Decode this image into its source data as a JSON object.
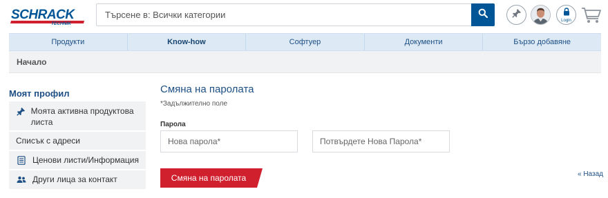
{
  "header": {
    "logo": {
      "line1": "SCHRACK",
      "line2": "TECHNIK"
    },
    "search": {
      "placeholder": "Търсене в: Всички категории"
    },
    "login_label": "Login"
  },
  "nav": {
    "items": [
      {
        "label": "Продукти",
        "bold": false
      },
      {
        "label": "Know-how",
        "bold": true
      },
      {
        "label": "Софтуер",
        "bold": false
      },
      {
        "label": "Документи",
        "bold": false
      },
      {
        "label": "Бързо добавяне",
        "bold": false
      }
    ]
  },
  "breadcrumb": {
    "home": "Начало"
  },
  "sidebar": {
    "title": "Моят профил",
    "items": [
      {
        "label": "Моята активна продуктова листа",
        "icon": "pin-icon"
      },
      {
        "label": "Списък с адреси",
        "icon": ""
      },
      {
        "label": "Ценови листи/Информация",
        "icon": "document-list-icon"
      },
      {
        "label": "Други лица за контакт",
        "icon": "contacts-icon"
      }
    ]
  },
  "main": {
    "title": "Смяна на паролата",
    "required_note": "*Задължително поле",
    "password_label": "Парола",
    "new_password_placeholder": "Нова парола*",
    "confirm_password_placeholder": "Потвърдете Нова Парола*",
    "submit_label": "Смяна на паролата",
    "back_link": "« Назад"
  },
  "colors": {
    "brand_blue": "#005596",
    "nav_bg": "#dde9f5",
    "button_red": "#d0202e",
    "sidebar_bg": "#f1f2f3"
  }
}
